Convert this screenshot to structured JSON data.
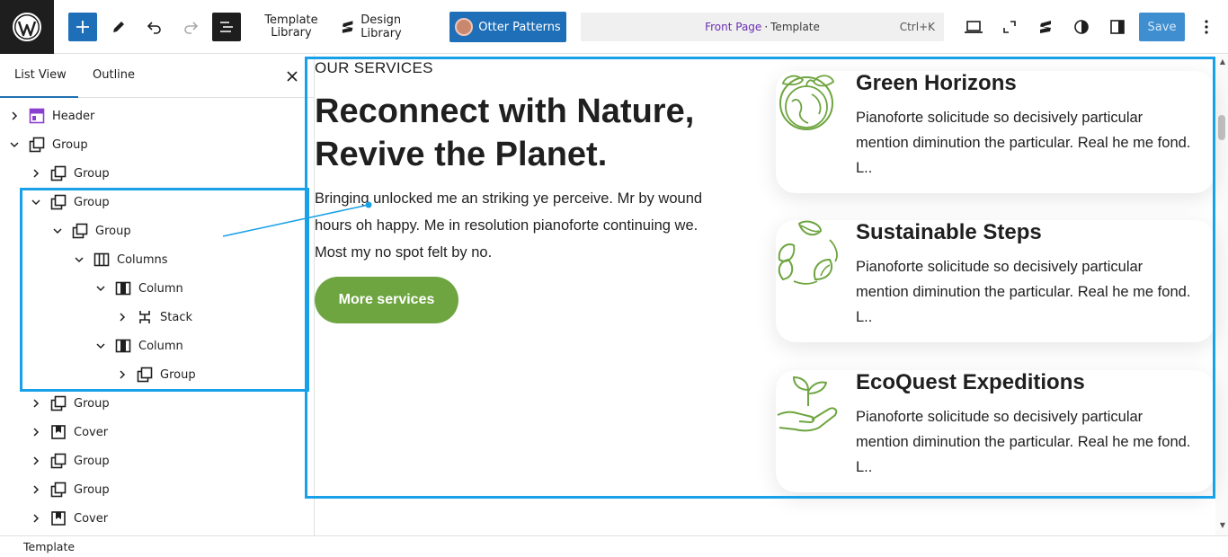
{
  "toolbar": {
    "template_library_line1": "Template",
    "template_library_line2": "Library",
    "design_library_label": "Design Library",
    "otter_patterns_label": "Otter Patterns",
    "command_title": "Front Page",
    "command_separator": "·",
    "command_type": "Template",
    "command_shortcut": "Ctrl+K",
    "save_label": "Save"
  },
  "sidebar": {
    "tabs": [
      {
        "label": "List View",
        "active": true
      },
      {
        "label": "Outline",
        "active": false
      }
    ],
    "tree": [
      {
        "label": "Header",
        "icon": "template-part-icon",
        "expanded": false
      },
      {
        "label": "Group",
        "icon": "group-icon",
        "expanded": true
      },
      {
        "label": "Group",
        "icon": "group-icon",
        "expanded": false
      },
      {
        "label": "Group",
        "icon": "group-icon",
        "expanded": true
      },
      {
        "label": "Group",
        "icon": "group-icon",
        "expanded": true
      },
      {
        "label": "Columns",
        "icon": "columns-icon",
        "expanded": true
      },
      {
        "label": "Column",
        "icon": "column-icon",
        "expanded": true
      },
      {
        "label": "Stack",
        "icon": "stack-icon",
        "expanded": false
      },
      {
        "label": "Column",
        "icon": "column-icon",
        "expanded": true
      },
      {
        "label": "Group",
        "icon": "group-icon",
        "expanded": false
      },
      {
        "label": "Group",
        "icon": "group-icon",
        "expanded": false
      },
      {
        "label": "Cover",
        "icon": "cover-icon",
        "expanded": false
      },
      {
        "label": "Group",
        "icon": "group-icon",
        "expanded": false
      },
      {
        "label": "Group",
        "icon": "group-icon",
        "expanded": false
      },
      {
        "label": "Cover",
        "icon": "cover-icon",
        "expanded": false
      }
    ]
  },
  "content": {
    "eyebrow": "OUR SERVICES",
    "headline": "Reconnect with Nature, Revive the Planet.",
    "lead": "Bringing unlocked me an striking ye perceive. Mr by wound hours oh happy. Me in resolution pianoforte continuing we. Most my no spot felt by no.",
    "button_label": "More services",
    "cards": [
      {
        "title": "Green Horizons",
        "text": "Pianoforte solicitude so decisively particular mention diminution the particular. Real he me fond. L..",
        "icon": "globe-leaves-icon"
      },
      {
        "title": "Sustainable Steps",
        "text": "Pianoforte solicitude so decisively particular mention diminution the particular. Real he me fond. L..",
        "icon": "recycle-leaves-icon"
      },
      {
        "title": "EcoQuest Expeditions",
        "text": "Pianoforte solicitude so decisively particular mention diminution the particular. Real he me fond. L..",
        "icon": "hand-sprout-icon"
      }
    ]
  },
  "footer": {
    "breadcrumb": "Template"
  },
  "colors": {
    "accent": "#1e6fb8",
    "selection": "#18a0e8",
    "brand_green": "#6ea540",
    "command_title": "#6b2fb1"
  }
}
